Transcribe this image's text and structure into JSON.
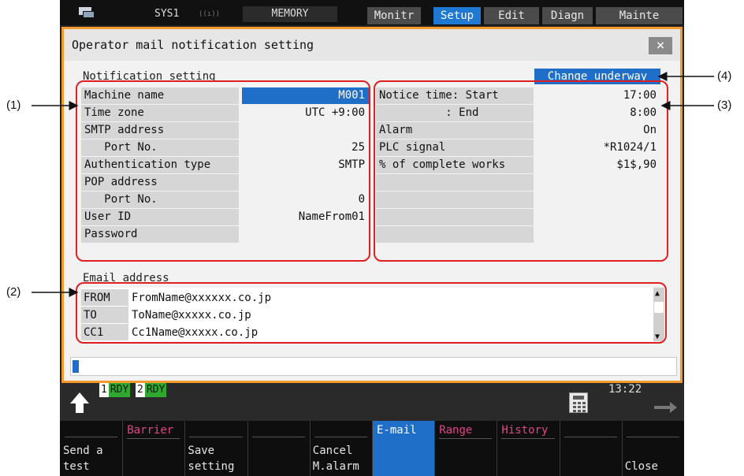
{
  "topbar": {
    "system": "SYS1",
    "mode": "MEMORY",
    "tabs": [
      {
        "label": "Monitr",
        "active": false
      },
      {
        "label": "Setup",
        "active": true
      },
      {
        "label": "Edit",
        "active": false
      },
      {
        "label": "Diagn",
        "active": false
      },
      {
        "label": "Mainte",
        "active": false
      }
    ]
  },
  "dialog": {
    "title": "Operator mail notification setting",
    "close_label": "×",
    "notification_label": "Notification setting",
    "change_badge": "Change underway",
    "left_rows": [
      {
        "key": "Machine name",
        "value": "M001"
      },
      {
        "key": "Time zone",
        "value": "UTC +9:00"
      },
      {
        "key": "SMTP address",
        "value": ""
      },
      {
        "key": "   Port No.",
        "value": "25"
      },
      {
        "key": "Authentication type",
        "value": "SMTP"
      },
      {
        "key": "POP address",
        "value": ""
      },
      {
        "key": "   Port No.",
        "value": "0"
      },
      {
        "key": "User ID",
        "value": "NameFrom01"
      },
      {
        "key": "Password",
        "value": ""
      }
    ],
    "right_rows": [
      {
        "key": "Notice time: Start",
        "value": "17:00"
      },
      {
        "key": "          : End",
        "value": "8:00"
      },
      {
        "key": "Alarm",
        "value": "On"
      },
      {
        "key": "PLC signal",
        "value": "*R1024/1"
      },
      {
        "key": "% of complete works",
        "value": "$1$,90"
      },
      {
        "key": "",
        "value": ""
      },
      {
        "key": "",
        "value": ""
      },
      {
        "key": "",
        "value": ""
      },
      {
        "key": "",
        "value": ""
      }
    ],
    "email_label": "Email address",
    "emails": [
      {
        "type": "FROM",
        "address": "FromName@xxxxxx.co.jp"
      },
      {
        "type": "TO",
        "address": "ToName@xxxxx.co.jp"
      },
      {
        "type": "CC1",
        "address": "Cc1Name@xxxxx.co.jp"
      }
    ]
  },
  "status": {
    "rdy1_num": "1",
    "rdy1": "RDY",
    "rdy2_num": "2",
    "rdy2": "RDY",
    "clock": "13:22"
  },
  "softkeys": [
    {
      "top": "",
      "bottom": "Send a\ntest",
      "active": false
    },
    {
      "top": "Barrier",
      "bottom": "",
      "active": false
    },
    {
      "top": "",
      "bottom": "Save\nsetting",
      "active": false
    },
    {
      "top": "",
      "bottom": "",
      "active": false
    },
    {
      "top": "",
      "bottom": "Cancel\nM.alarm",
      "active": false
    },
    {
      "top": "E-mail",
      "bottom": "",
      "active": true
    },
    {
      "top": "Range",
      "bottom": "",
      "active": false
    },
    {
      "top": "History",
      "bottom": "",
      "active": false
    },
    {
      "top": "",
      "bottom": "",
      "active": false
    },
    {
      "top": "",
      "bottom": "Close",
      "active": false
    }
  ],
  "annotations": {
    "a1": "(1)",
    "a2": "(2)",
    "a3": "(3)",
    "a4": "(4)"
  },
  "colors": {
    "frame": "#f29a2e",
    "accent": "#1f6ec8",
    "highlight": "#e02020",
    "softkey_upper": "#e4448a"
  }
}
